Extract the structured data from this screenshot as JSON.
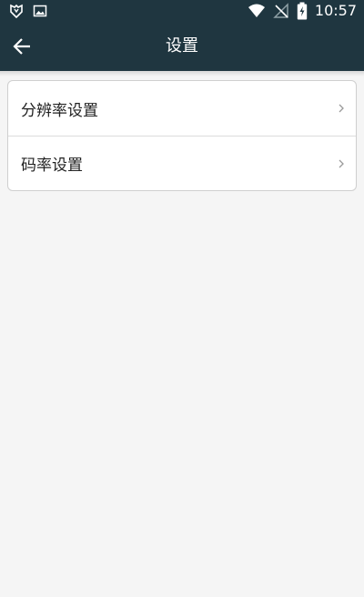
{
  "status_bar": {
    "time": "10:57",
    "icons": [
      "shield-badge-icon",
      "image-notification-icon",
      "wifi-icon",
      "no-signal-icon",
      "battery-charging-icon"
    ]
  },
  "app_bar": {
    "title": "设置",
    "back_icon": "arrow-left-icon"
  },
  "settings": {
    "items": [
      {
        "label": "分辨率设置",
        "icon": "chevron-right-icon"
      },
      {
        "label": "码率设置",
        "icon": "chevron-right-icon"
      }
    ]
  },
  "colors": {
    "header_bg": "#1f3640",
    "page_bg": "#f5f5f5",
    "card_bg": "#ffffff",
    "text_primary": "#222222",
    "chevron": "#9a9a9a"
  }
}
